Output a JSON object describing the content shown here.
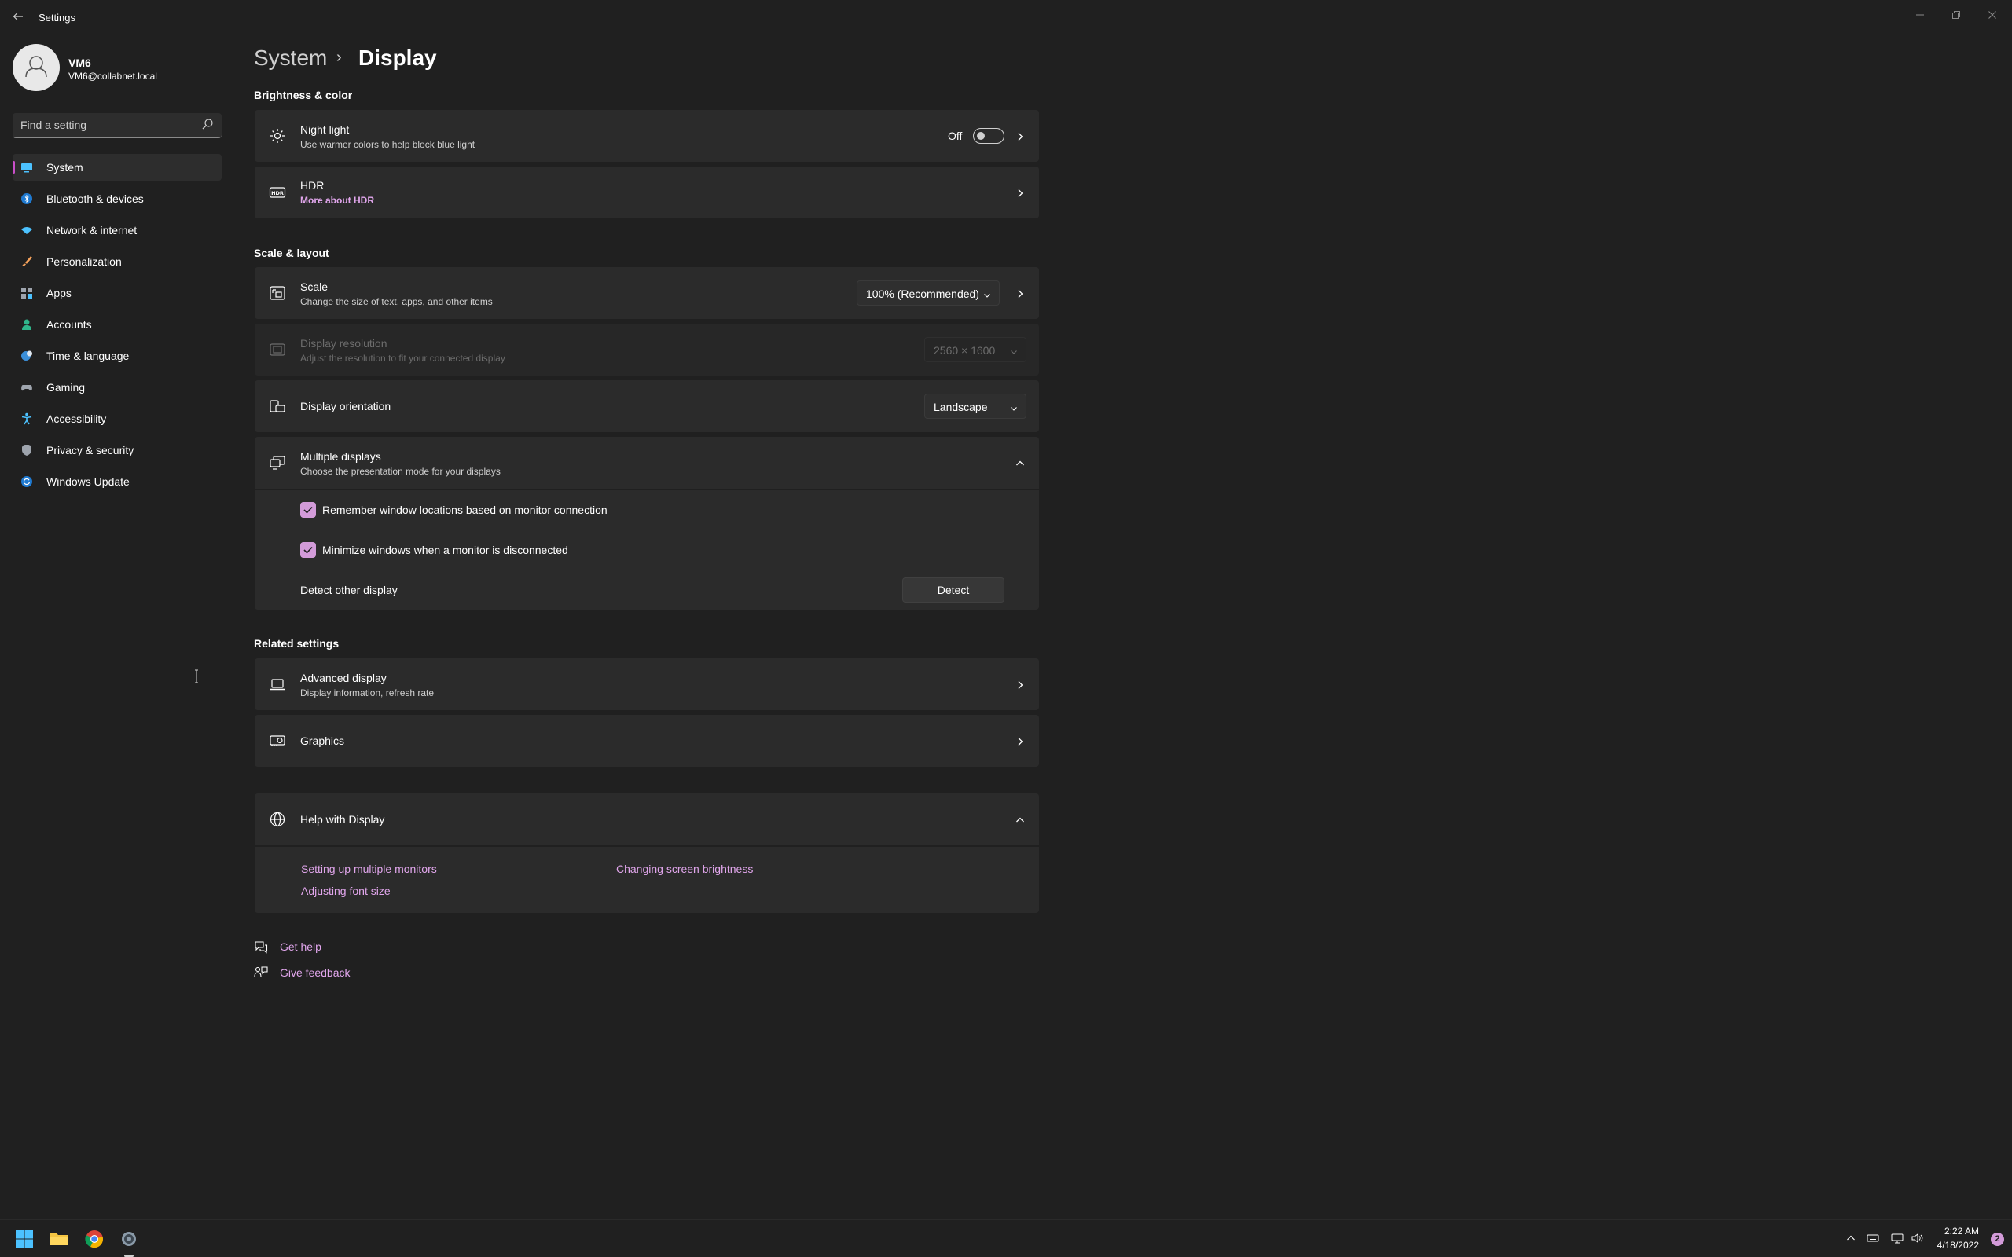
{
  "window": {
    "title": "Settings",
    "controls": [
      "minimize",
      "restore",
      "close"
    ]
  },
  "profile": {
    "name": "VM6",
    "email": "VM6@collabnet.local"
  },
  "search": {
    "placeholder": "Find a setting"
  },
  "sidebar": {
    "items": [
      {
        "label": "System",
        "icon": "monitor-icon",
        "selected": true
      },
      {
        "label": "Bluetooth & devices",
        "icon": "bluetooth-icon"
      },
      {
        "label": "Network & internet",
        "icon": "wifi-icon"
      },
      {
        "label": "Personalization",
        "icon": "brush-icon"
      },
      {
        "label": "Apps",
        "icon": "apps-icon"
      },
      {
        "label": "Accounts",
        "icon": "person-icon"
      },
      {
        "label": "Time & language",
        "icon": "globe-clock-icon"
      },
      {
        "label": "Gaming",
        "icon": "gamepad-icon"
      },
      {
        "label": "Accessibility",
        "icon": "accessibility-icon"
      },
      {
        "label": "Privacy & security",
        "icon": "shield-icon"
      },
      {
        "label": "Windows Update",
        "icon": "update-icon"
      }
    ]
  },
  "breadcrumb": {
    "parent": "System",
    "separator": "›",
    "current": "Display"
  },
  "sections": {
    "brightness": "Brightness & color",
    "scale": "Scale & layout",
    "related": "Related settings"
  },
  "night_light": {
    "title": "Night light",
    "subtitle": "Use warmer colors to help block blue light",
    "state_label": "Off",
    "on": false
  },
  "hdr": {
    "title": "HDR",
    "link": "More about HDR"
  },
  "scale": {
    "title": "Scale",
    "subtitle": "Change the size of text, apps, and other items",
    "value": "100% (Recommended)"
  },
  "resolution": {
    "title": "Display resolution",
    "subtitle": "Adjust the resolution to fit your connected display",
    "value": "2560 × 1600",
    "disabled": true
  },
  "orientation": {
    "title": "Display orientation",
    "value": "Landscape"
  },
  "multiple_displays": {
    "title": "Multiple displays",
    "subtitle": "Choose the presentation mode for your displays",
    "expanded": true,
    "remember_label": "Remember window locations based on monitor connection",
    "remember_checked": true,
    "minimize_label": "Minimize windows when a monitor is disconnected",
    "minimize_checked": true,
    "detect_label": "Detect other display",
    "detect_button": "Detect"
  },
  "advanced_display": {
    "title": "Advanced display",
    "subtitle": "Display information, refresh rate"
  },
  "graphics": {
    "title": "Graphics"
  },
  "help": {
    "title": "Help with Display",
    "links": [
      "Setting up multiple monitors",
      "Changing screen brightness",
      "Adjusting font size"
    ]
  },
  "footer": {
    "get_help": "Get help",
    "give_feedback": "Give feedback"
  },
  "taskbar": {
    "apps": [
      "windows-start-icon",
      "file-explorer-icon",
      "chrome-icon",
      "settings-icon"
    ],
    "time": "2:22 AM",
    "date": "4/18/2022",
    "notifications": "2"
  },
  "colors": {
    "accent": "#c94fc9",
    "accent_light": "#e1a6ec",
    "background": "#202020",
    "card": "#2b2b2b"
  }
}
